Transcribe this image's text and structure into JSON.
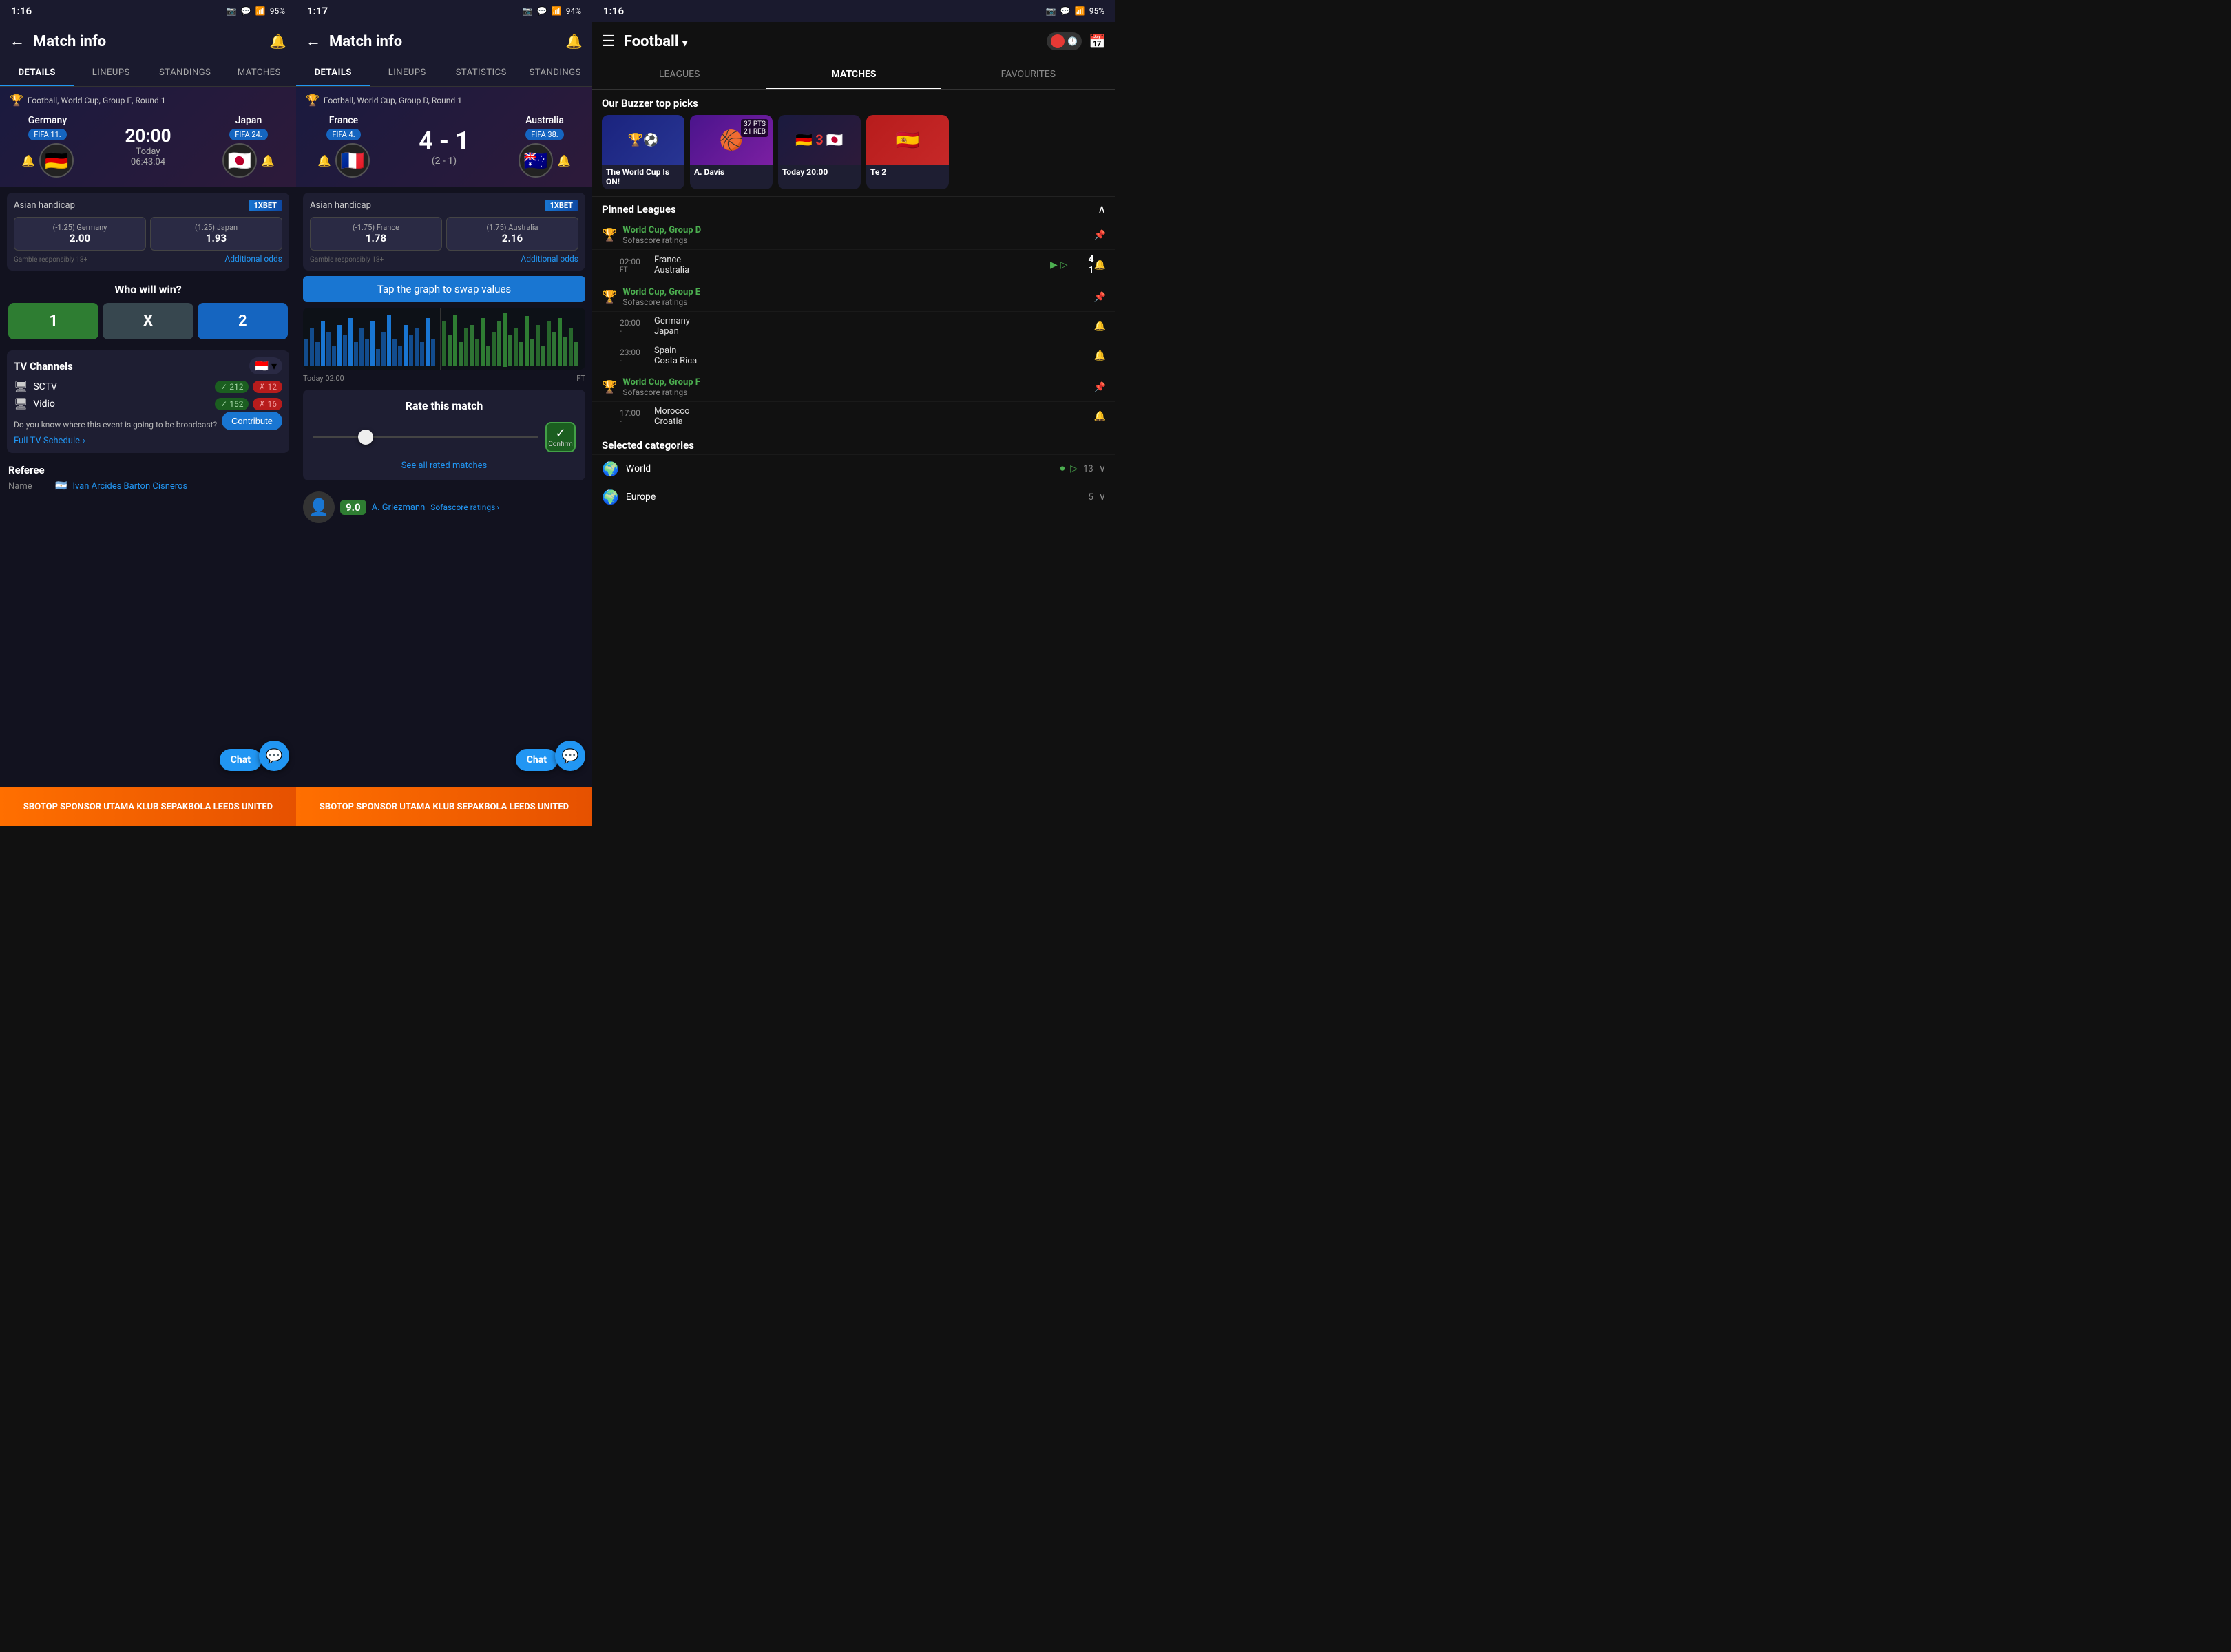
{
  "panel1": {
    "status": {
      "time": "1:16",
      "battery": "95%"
    },
    "header": {
      "title": "Match info",
      "back": "←",
      "bell": "🔔"
    },
    "tabs": [
      "DETAILS",
      "LINEUPS",
      "STANDINGS",
      "MATCHES"
    ],
    "active_tab": 0,
    "match": {
      "category": "Football, World Cup, Group E, Round 1",
      "team1": "Germany",
      "team2": "Japan",
      "fifa1": "FIFA 11.",
      "fifa2": "FIFA 24.",
      "flag1": "🇩🇪",
      "flag2": "🇯🇵",
      "time": "20:00",
      "date": "Today",
      "countdown": "06:43:04"
    },
    "odds": {
      "label": "Asian handicap",
      "brand": "1XBET",
      "opt1_name": "(-1.25) Germany",
      "opt1_val": "2.00",
      "opt2_name": "(1.25) Japan",
      "opt2_val": "1.93",
      "gamble": "Gamble responsibly 18+",
      "add_odds": "Additional odds"
    },
    "wwwin": {
      "title": "Who will win?",
      "btn1": "1",
      "btnx": "X",
      "btn2": "2"
    },
    "tv": {
      "title": "TV Channels",
      "channels": [
        {
          "name": "SCTV",
          "green": "212",
          "red": "12"
        },
        {
          "name": "Vidio",
          "green": "152",
          "red": "16"
        }
      ],
      "question": "Do you know where this event is going to be broadcast?",
      "contribute": "Contribute",
      "schedule": "Full TV Schedule"
    },
    "referee": {
      "title": "Referee",
      "key": "Name",
      "flag": "🇦🇷",
      "val": "Ivan Arcides Barton Cisneros"
    },
    "chat_label": "Chat",
    "ad": "SBOTOP  SPONSOR UTAMA KLUB SEPAKBOLA  LEEDS UNITED"
  },
  "panel2": {
    "status": {
      "time": "1:17",
      "battery": "94%"
    },
    "header": {
      "title": "Match info",
      "back": "←",
      "bell": "🔔"
    },
    "tabs": [
      "DETAILS",
      "LINEUPS",
      "STATISTICS",
      "STANDINGS"
    ],
    "active_tab": 0,
    "match": {
      "category": "Football, World Cup, Group D, Round 1",
      "team1": "France",
      "team2": "Australia",
      "fifa1": "FIFA 4.",
      "fifa2": "FIFA 38.",
      "flag1": "🇫🇷",
      "flag2": "🇦🇺",
      "score": "4 - 1",
      "score_sub": "(2 - 1)"
    },
    "odds": {
      "label": "Asian handicap",
      "brand": "1XBET",
      "opt1_name": "(-1.75) France",
      "opt1_val": "1.78",
      "opt2_name": "(1.75) Australia",
      "opt2_val": "2.16",
      "gamble": "Gamble responsibly 18+",
      "add_odds": "Additional odds"
    },
    "tap_graph": "Tap the graph to swap values",
    "chart_label_left": "Today 02:00",
    "chart_label_right": "FT",
    "rate": {
      "title": "Rate this match",
      "confirm": "Confirm",
      "see_all": "See all rated matches"
    },
    "player": {
      "score": "9.0",
      "name": "A. Griezmann",
      "sofascore": "Sofascore ratings"
    },
    "chat_label": "Chat",
    "ad": "SBOTOP  SPONSOR UTAMA KLUB SEPAKBOLA  LEEDS UNITED"
  },
  "panel3": {
    "status": {
      "time": "1:16",
      "battery": "95%"
    },
    "header": {
      "title": "Football",
      "dropdown": "▾"
    },
    "tabs": [
      "LEAGUES",
      "MATCHES",
      "FAVOURITES"
    ],
    "active_tab": 1,
    "buzzer": {
      "title": "Our Buzzer top picks",
      "cards": [
        {
          "label": "The World Cup Is ON!",
          "icon": "⚽",
          "extra": ""
        },
        {
          "label": "A. Davis",
          "icon": "🏀",
          "pts": "37 PTS\n21 REB"
        },
        {
          "label": "Today 20:00",
          "icon": "🇩🇪🇯🇵",
          "extra": "3"
        },
        {
          "label": "Te 2",
          "icon": "🇪🇸",
          "extra": ""
        }
      ]
    },
    "pinned": {
      "title": "Pinned Leagues",
      "groups": [
        {
          "name": "World Cup, Group D",
          "sub": "Sofascore ratings",
          "matches": [
            {
              "time": "02:00",
              "status": "FT",
              "t1": "France",
              "t2": "Australia",
              "s1": "4",
              "s2": "1",
              "live": true
            }
          ]
        },
        {
          "name": "World Cup, Group E",
          "sub": "Sofascore ratings",
          "matches": [
            {
              "time": "20:00",
              "status": "-",
              "t1": "Germany",
              "t2": "Japan",
              "s1": "",
              "s2": ""
            },
            {
              "time": "23:00",
              "status": "-",
              "t1": "Spain",
              "t2": "Costa Rica",
              "s1": "",
              "s2": ""
            }
          ]
        },
        {
          "name": "World Cup, Group F",
          "sub": "Sofascore ratings",
          "matches": [
            {
              "time": "17:00",
              "status": "-",
              "t1": "Morocco",
              "t2": "Croatia",
              "s1": "",
              "s2": ""
            }
          ]
        }
      ]
    },
    "categories": {
      "title": "Selected categories",
      "items": [
        {
          "name": "World",
          "icon": "🌍",
          "count": "13"
        },
        {
          "name": "Europe",
          "icon": "🌍",
          "count": "5"
        }
      ]
    }
  }
}
